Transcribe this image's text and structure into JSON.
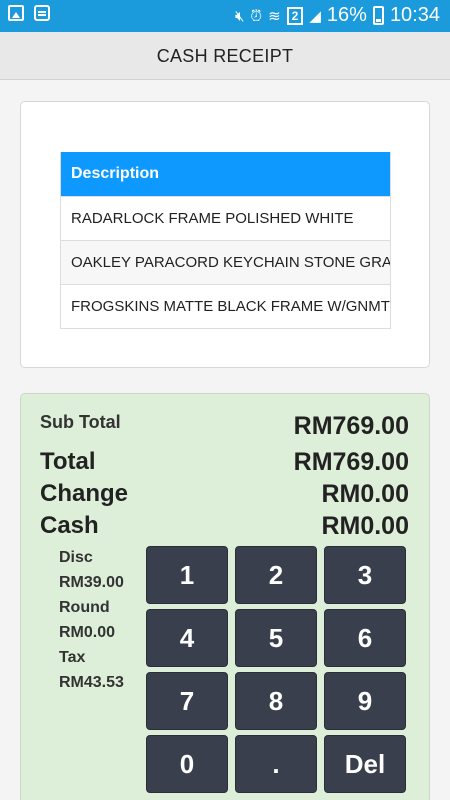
{
  "status_bar": {
    "battery": "16%",
    "time": "10:34",
    "sim": "2",
    "icons": [
      "image-icon",
      "message-icon",
      "mute-icon",
      "alarm-icon",
      "wifi-icon",
      "sim-icon",
      "signal-icon",
      "battery-icon"
    ]
  },
  "app_bar": {
    "title": "CASH RECEIPT"
  },
  "items_table": {
    "header": "Description",
    "rows": [
      "RADARLOCK FRAME POLISHED WHITE",
      "OAKLEY PARACORD KEYCHAIN STONE GRAY",
      "FROGSKINS MATTE BLACK FRAME W/GNMTL"
    ]
  },
  "totals": {
    "subtotal_label": "Sub Total",
    "subtotal_value": "RM769.00",
    "total_label": "Total",
    "total_value": "RM769.00",
    "change_label": "Change",
    "change_value": "RM0.00",
    "cash_label": "Cash",
    "cash_value": "RM0.00"
  },
  "summary": {
    "disc_label": "Disc",
    "disc_value": "RM39.00",
    "round_label": "Round",
    "round_value": "RM0.00",
    "tax_label": "Tax",
    "tax_value": "RM43.53"
  },
  "keypad": [
    "1",
    "2",
    "3",
    "4",
    "5",
    "6",
    "7",
    "8",
    "9",
    "0",
    ".",
    "Del"
  ],
  "colors": {
    "status_bar": "#1b9bdb",
    "table_header": "#0d99ff",
    "panel_bg": "#ddefd9",
    "key_bg": "#3a3f4d"
  }
}
